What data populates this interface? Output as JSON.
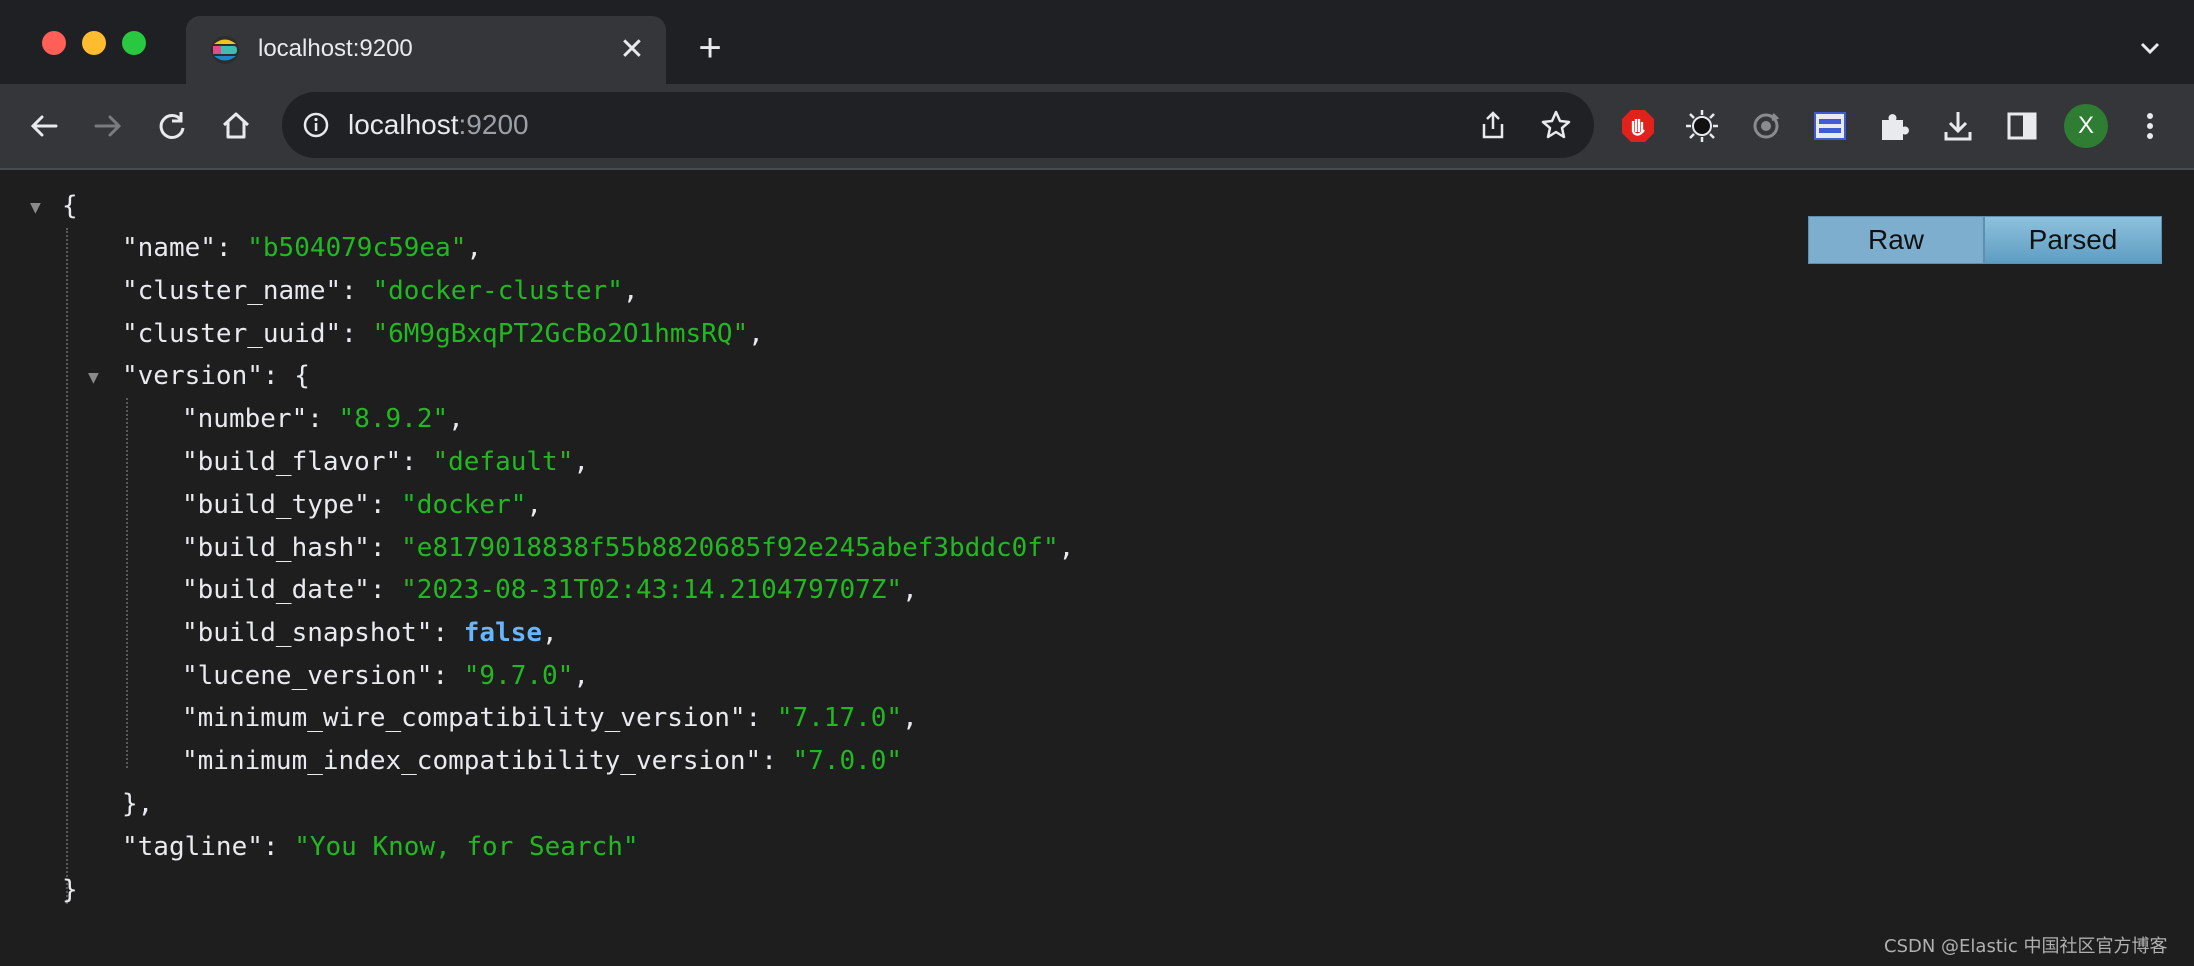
{
  "tab": {
    "title": "localhost:9200",
    "close": "✕"
  },
  "new_tab": "+",
  "omnibox": {
    "host": "localhost",
    "port": ":9200"
  },
  "profile": {
    "initial": "X"
  },
  "view_toggle": {
    "raw": "Raw",
    "parsed": "Parsed"
  },
  "json_lines": {
    "open": "{",
    "name_key": "\"name\"",
    "name_val": "\"b504079c59ea\"",
    "cluster_name_key": "\"cluster_name\"",
    "cluster_name_val": "\"docker-cluster\"",
    "cluster_uuid_key": "\"cluster_uuid\"",
    "cluster_uuid_val": "\"6M9gBxqPT2GcBo2O1hmsRQ\"",
    "version_key": "\"version\"",
    "version_open": "{",
    "number_key": "\"number\"",
    "number_val": "\"8.9.2\"",
    "build_flavor_key": "\"build_flavor\"",
    "build_flavor_val": "\"default\"",
    "build_type_key": "\"build_type\"",
    "build_type_val": "\"docker\"",
    "build_hash_key": "\"build_hash\"",
    "build_hash_val": "\"e8179018838f55b8820685f92e245abef3bddc0f\"",
    "build_date_key": "\"build_date\"",
    "build_date_val": "\"2023-08-31T02:43:14.210479707Z\"",
    "build_snapshot_key": "\"build_snapshot\"",
    "build_snapshot_val": "false",
    "lucene_version_key": "\"lucene_version\"",
    "lucene_version_val": "\"9.7.0\"",
    "min_wire_key": "\"minimum_wire_compatibility_version\"",
    "min_wire_val": "\"7.17.0\"",
    "min_index_key": "\"minimum_index_compatibility_version\"",
    "min_index_val": "\"7.0.0\"",
    "version_close": "},",
    "tagline_key": "\"tagline\"",
    "tagline_val": "\"You Know, for Search\"",
    "close": "}"
  },
  "watermark": "CSDN @Elastic 中国社区官方博客",
  "colors": {
    "string": "#22b822",
    "boolean": "#66b7ff",
    "background": "#1e1e1e"
  }
}
